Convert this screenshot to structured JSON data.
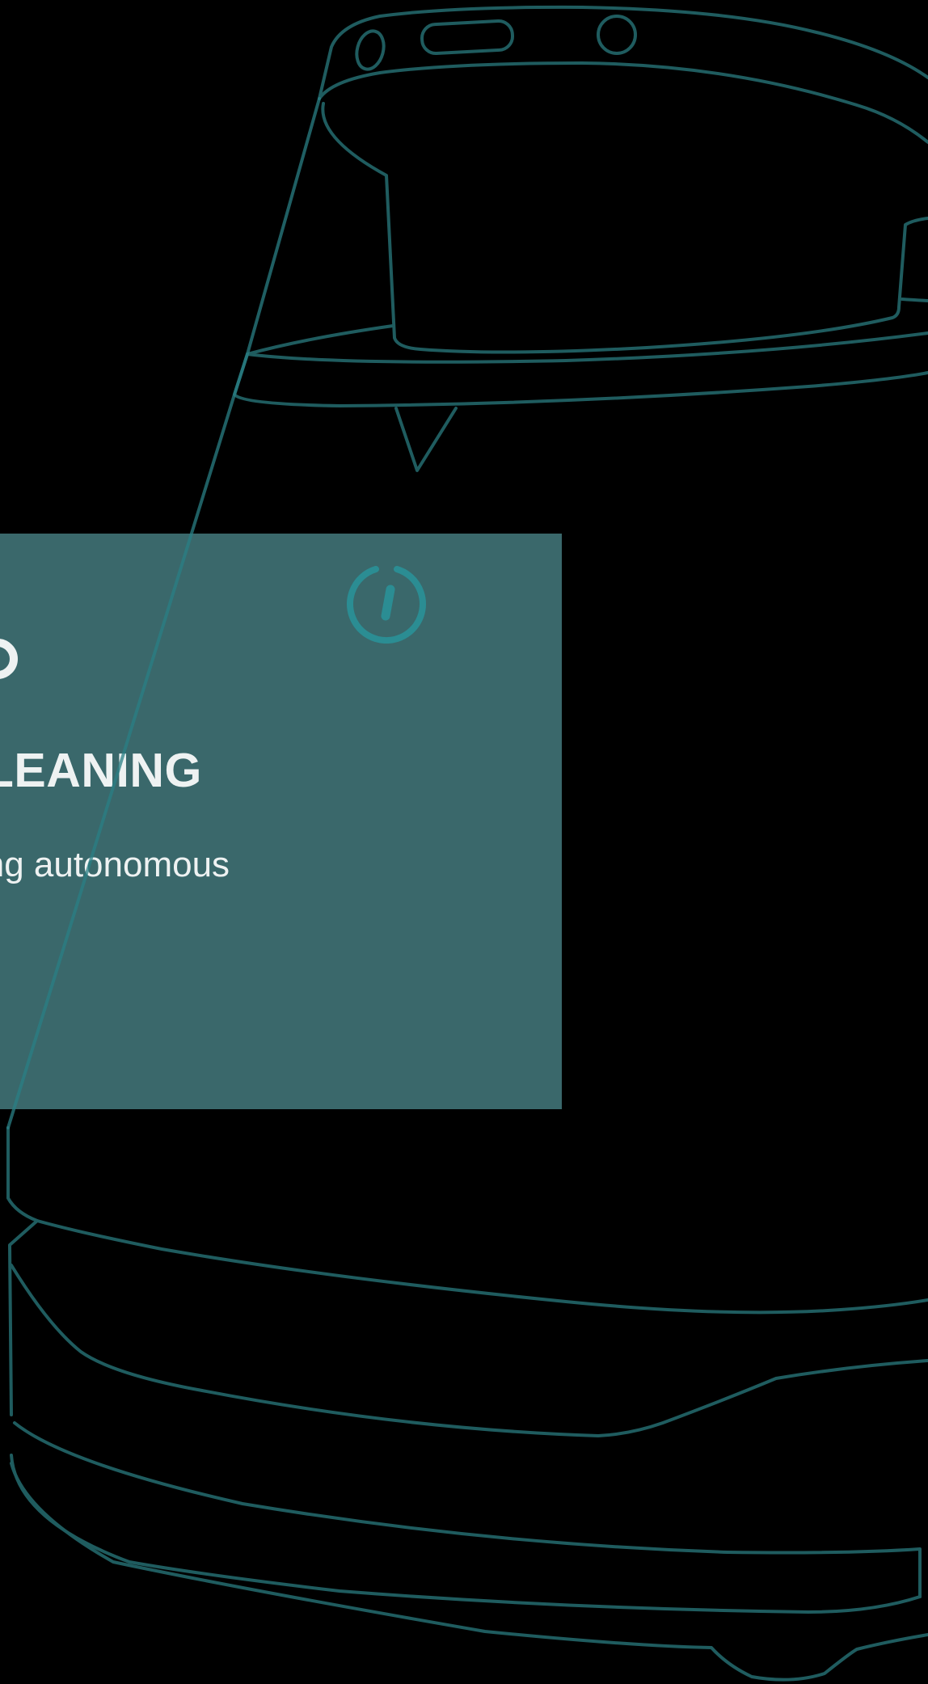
{
  "hero": {
    "title": "URE OF CLEANING",
    "subtitle": "ading autonomous"
  },
  "icons": {
    "power": "power-icon",
    "brand": "brand-logo-icon"
  },
  "colors": {
    "background": "#000000",
    "outline": "#1f5c5f",
    "card": "#4a8589",
    "icon_teal": "#2b8d93",
    "text": "#eef2f2"
  }
}
